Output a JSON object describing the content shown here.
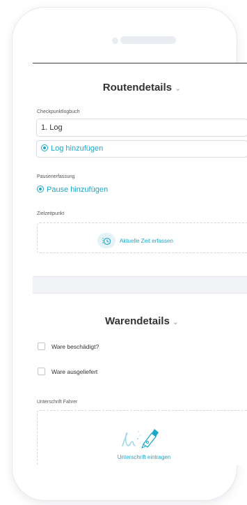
{
  "route": {
    "title": "Routendetails",
    "checkpoint_label": "Checkpunktlogbuch",
    "log_value": "1. Log",
    "add_log": "Log hinzufügen",
    "pause_label": "Pausenerfassung",
    "add_pause": "Pause hinzufügen",
    "target_label": "Zielzeitpunkt",
    "capture_time": "Aktuelle Zeit erfassen"
  },
  "goods": {
    "title": "Warendetails",
    "damaged": "Ware beschädigt?",
    "delivered": "Ware ausgeliefert",
    "driver_signature_label": "Unterschrift Fahrer",
    "sign_action": "Unterschrift eintragen"
  },
  "colors": {
    "accent": "#1ca7c7"
  },
  "icons": {
    "chevron": "chevron-down-icon",
    "add": "circle-plus-icon",
    "clock": "clock-icon",
    "signature": "signature-pen-icon"
  }
}
